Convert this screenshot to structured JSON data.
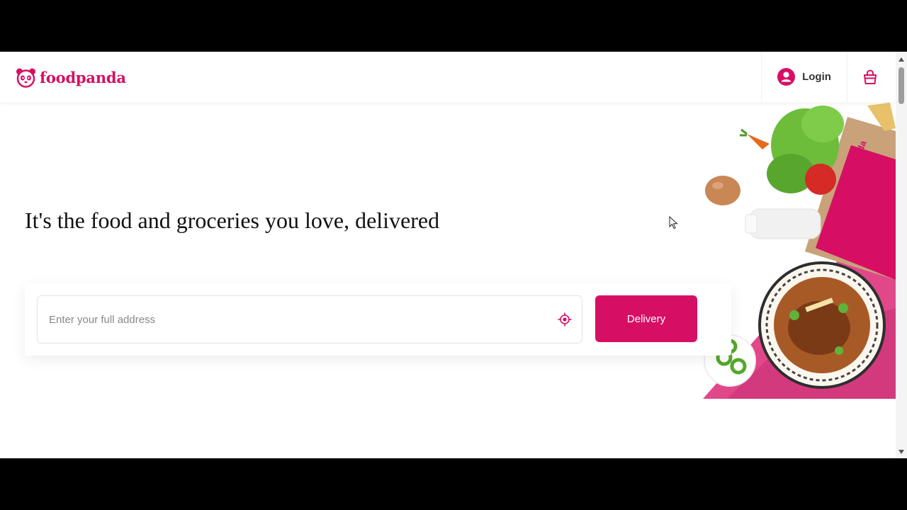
{
  "header": {
    "logo_text": "foodpanda",
    "login_label": "Login"
  },
  "hero": {
    "headline": "It's the food and groceries you love, delivered",
    "address_placeholder": "Enter your full address",
    "address_value": "",
    "delivery_label": "Delivery",
    "bag_brand_text": "foodpanda"
  },
  "icons": {
    "logo": "panda-logo-icon",
    "login": "user-icon",
    "cart": "shopping-bag-icon",
    "locate": "crosshair-locate-icon"
  },
  "colors": {
    "brand": "#d70f64",
    "background": "#ffffff",
    "text": "#111111"
  }
}
